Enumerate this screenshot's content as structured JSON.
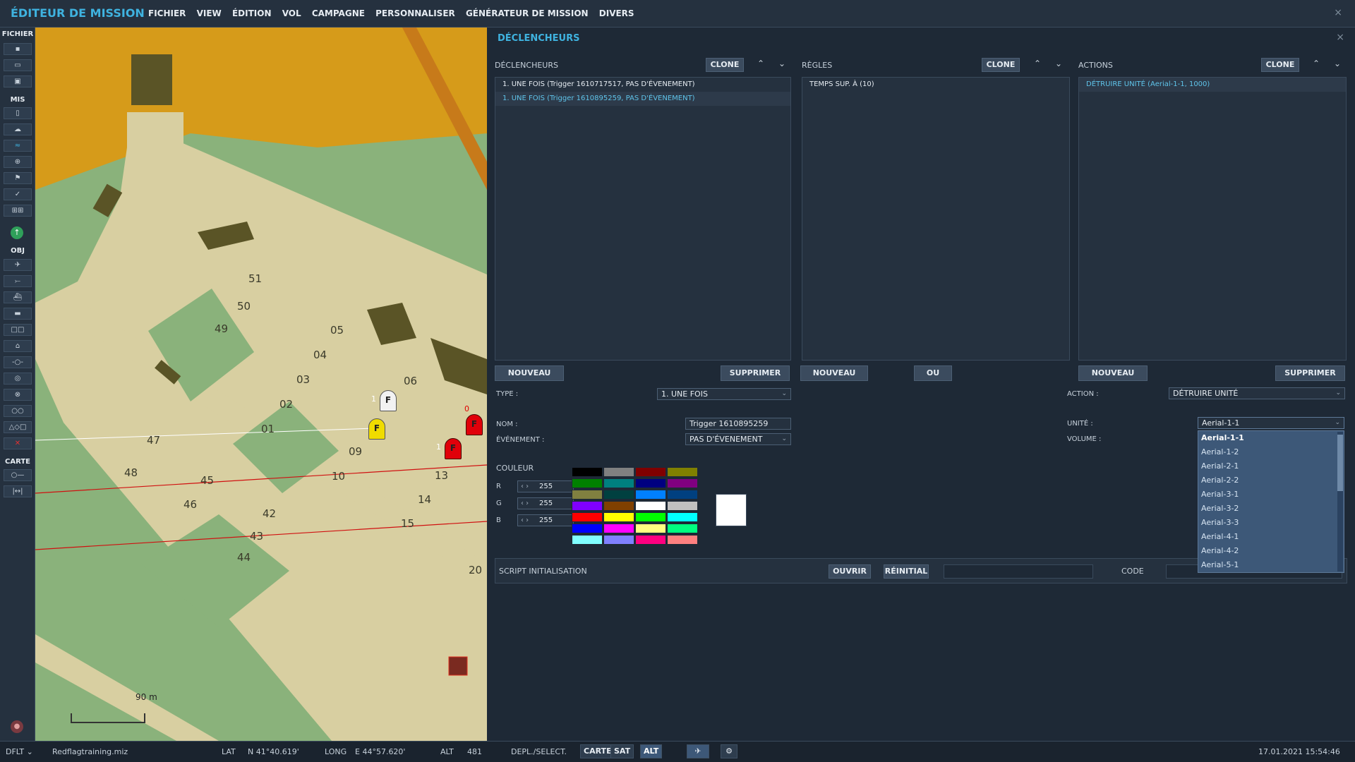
{
  "app": {
    "title": "ÉDITEUR DE MISSION",
    "close": "×"
  },
  "menu": [
    "FICHIER",
    "VIEW",
    "ÉDITION",
    "VOL",
    "CAMPAGNE",
    "PERSONNALISER",
    "GÉNÉRATEUR DE MISSION",
    "DIVERS"
  ],
  "toolbar": {
    "sections": [
      "FICHIER",
      "MIS",
      "OBJ",
      "CARTE"
    ]
  },
  "map": {
    "scale_label": "90 m",
    "taxi_numbers": [
      "51",
      "50",
      "49",
      "05",
      "04",
      "03",
      "06",
      "02",
      "01",
      "47",
      "48",
      "45",
      "46",
      "42",
      "43",
      "44",
      "09",
      "10",
      "13",
      "14",
      "15",
      "20"
    ],
    "markers": [
      {
        "letter": "F",
        "color": "#f2f2f2",
        "label": "1"
      },
      {
        "letter": "F",
        "color": "#f0dc00",
        "label": ""
      },
      {
        "letter": "F",
        "color": "#e0000a",
        "label": "1"
      },
      {
        "letter": "F",
        "color": "#e0000a",
        "label": "0"
      }
    ]
  },
  "panel": {
    "title": "DÉCLENCHEURS",
    "close": "×",
    "triggers": {
      "header": "DÉCLENCHEURS",
      "clone": "CLONE",
      "items": [
        "1. UNE FOIS (Trigger 1610717517, PAS D'ÉVENEMENT)",
        "1. UNE FOIS (Trigger 1610895259, PAS D'ÉVENEMENT)"
      ],
      "new": "NOUVEAU",
      "delete": "SUPPRIMER"
    },
    "rules": {
      "header": "RÈGLES",
      "clone": "CLONE",
      "items": [
        "TEMPS SUP. À (10)"
      ],
      "new": "NOUVEAU",
      "or": "OU"
    },
    "actions": {
      "header": "ACTIONS",
      "clone": "CLONE",
      "items": [
        "DÉTRUIRE UNITÉ (Aerial-1-1, 1000)"
      ],
      "new": "NOUVEAU",
      "delete": "SUPPRIMER"
    },
    "form": {
      "type_label": "TYPE :",
      "type_value": "1. UNE FOIS",
      "name_label": "NOM :",
      "name_value": "Trigger 1610895259",
      "event_label": "ÉVÉNEMENT :",
      "event_value": "PAS D'ÉVENEMENT",
      "color_label": "COULEUR",
      "r_label": "R",
      "r_value": "255",
      "g_label": "G",
      "g_value": "255",
      "b_label": "B",
      "b_value": "255",
      "action_label": "ACTION :",
      "action_value": "DÉTRUIRE UNITÉ",
      "unit_label": "UNITÉ :",
      "unit_value": "Aerial-1-1",
      "volume_label": "VOLUME :",
      "script_label": "SCRIPT INITIALISATION",
      "open": "OUVRIR",
      "reset": "RÉINITIAL",
      "code_label": "CODE"
    },
    "unit_options": [
      "Aerial-1-1",
      "Aerial-1-2",
      "Aerial-2-1",
      "Aerial-2-2",
      "Aerial-3-1",
      "Aerial-3-2",
      "Aerial-3-3",
      "Aerial-4-1",
      "Aerial-4-2",
      "Aerial-5-1"
    ],
    "swatch_colors": [
      "#000000",
      "#808080",
      "#800000",
      "#808000",
      "#008000",
      "#008080",
      "#000080",
      "#800080",
      "#808040",
      "#004040",
      "#0080ff",
      "#004080",
      "#8000ff",
      "#804000",
      "#ffffff",
      "#c0c0c0",
      "#ff0000",
      "#ffff00",
      "#00ff00",
      "#00ffff",
      "#0000ff",
      "#ff00ff",
      "#ffff80",
      "#00ff80",
      "#80ffff",
      "#8080ff",
      "#ff0080",
      "#ff8080"
    ],
    "selected_color": "#ffffff"
  },
  "status": {
    "profile": "DFLT",
    "file": "Redflagtraining.miz",
    "lat_label": "LAT",
    "lat": "N 41°40.619'",
    "long_label": "LONG",
    "long": "E 44°57.620'",
    "alt_label": "ALT",
    "alt": "481",
    "mode": "DEPL./SELECT.",
    "map_btn": "CARTE",
    "sat_btn": "SAT",
    "alt_btn": "ALT",
    "datetime": "17.01.2021 15:54:46"
  }
}
